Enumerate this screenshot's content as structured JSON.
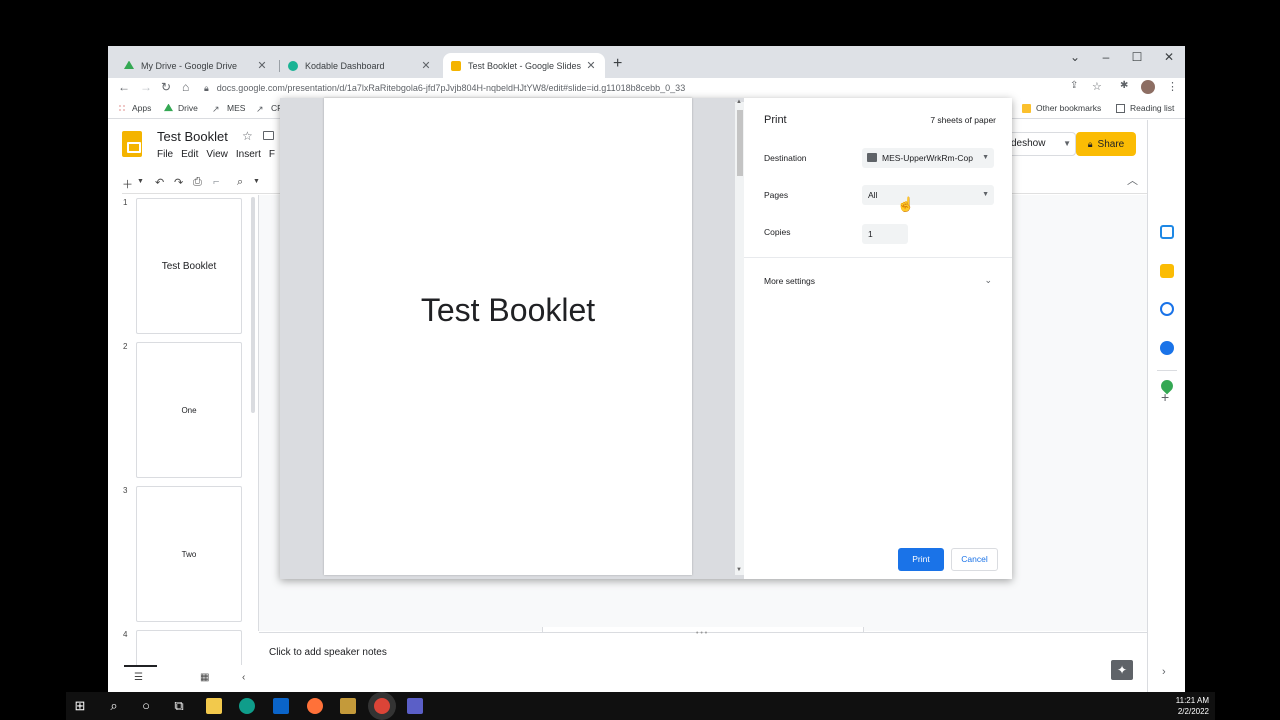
{
  "browser": {
    "tabs": [
      {
        "title": "My Drive - Google Drive",
        "favicon_color": "#34a853"
      },
      {
        "title": "Kodable Dashboard",
        "favicon_color": "#1ab394"
      },
      {
        "title": "Test Booklet - Google Slides",
        "favicon_color": "#f4b400"
      }
    ],
    "new_tab": "+",
    "url": "docs.google.com/presentation/d/1a7lxRaRitebgola6-jfd7pJvjb804H-nqbeldHJtYW8/edit#slide=id.g11018b8cebb_0_33",
    "bookmarks": [
      "Apps",
      "Drive",
      "MES",
      "CR"
    ],
    "other_bookmarks": "Other bookmarks",
    "reading_list": "Reading list"
  },
  "slides": {
    "doc_title": "Test Booklet",
    "menu": [
      "File",
      "Edit",
      "View",
      "Insert",
      "F"
    ],
    "slideshow_label": "deshow",
    "share_label": "Share",
    "accent_color": "#fbbc04",
    "thumbnails": [
      {
        "num": "1",
        "text": "Test Booklet"
      },
      {
        "num": "2",
        "text": "One"
      },
      {
        "num": "3",
        "text": "Two"
      },
      {
        "num": "4",
        "text": ""
      }
    ],
    "speaker_notes_placeholder": "Click to add speaker notes"
  },
  "print_dialog": {
    "title": "Print",
    "sheets": "7 sheets of paper",
    "destination_label": "Destination",
    "destination_value": "MES-UpperWrkRm-Cop",
    "pages_label": "Pages",
    "pages_value": "All",
    "copies_label": "Copies",
    "copies_value": "1",
    "more_settings": "More settings",
    "print_button": "Print",
    "cancel_button": "Cancel",
    "print_button_color": "#1a73e8",
    "preview_text": "Test Booklet"
  },
  "taskbar": {
    "time": "11:21 AM",
    "date": "2/2/2022"
  }
}
